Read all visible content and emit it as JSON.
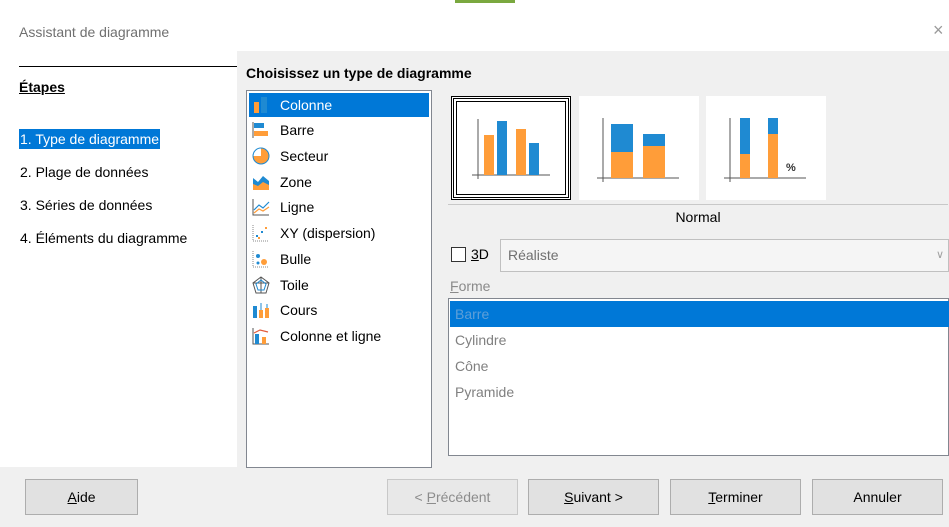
{
  "window": {
    "title": "Assistant de diagramme",
    "close_glyph": "×"
  },
  "steps": {
    "heading": "Étapes",
    "items": [
      {
        "label": "1. Type de diagramme",
        "active": true
      },
      {
        "label": "2. Plage de données",
        "active": false
      },
      {
        "label": "3. Séries de données",
        "active": false
      },
      {
        "label": "4. Éléments du diagramme",
        "active": false
      }
    ]
  },
  "main": {
    "title": "Choisissez un type de diagramme",
    "chart_types": [
      {
        "label": "Colonne",
        "icon": "column-chart-icon",
        "selected": true
      },
      {
        "label": "Barre",
        "icon": "bar-chart-icon",
        "selected": false
      },
      {
        "label": "Secteur",
        "icon": "pie-chart-icon",
        "selected": false
      },
      {
        "label": "Zone",
        "icon": "area-chart-icon",
        "selected": false
      },
      {
        "label": "Ligne",
        "icon": "line-chart-icon",
        "selected": false
      },
      {
        "label": "XY (dispersion)",
        "icon": "scatter-chart-icon",
        "selected": false
      },
      {
        "label": "Bulle",
        "icon": "bubble-chart-icon",
        "selected": false
      },
      {
        "label": "Toile",
        "icon": "net-chart-icon",
        "selected": false
      },
      {
        "label": "Cours",
        "icon": "stock-chart-icon",
        "selected": false
      },
      {
        "label": "Colonne et ligne",
        "icon": "column-line-chart-icon",
        "selected": false
      }
    ],
    "variants": {
      "caption": "Normal",
      "items": [
        {
          "name": "normal",
          "icon": "column-normal-icon",
          "selected": true
        },
        {
          "name": "stacked",
          "icon": "column-stacked-icon",
          "selected": false
        },
        {
          "name": "percent-stacked",
          "icon": "column-percent-stacked-icon",
          "selected": false,
          "badge": "%"
        }
      ]
    },
    "three_d": {
      "label_underlined": "3",
      "label_rest": "D",
      "checked": false,
      "combo_value": "Réaliste",
      "combo_arrow": "∨"
    },
    "shape": {
      "label_underlined": "F",
      "label_rest": "orme",
      "items": [
        {
          "label": "Barre",
          "selected": true
        },
        {
          "label": "Cylindre",
          "selected": false
        },
        {
          "label": "Cône",
          "selected": false
        },
        {
          "label": "Pyramide",
          "selected": false
        }
      ]
    }
  },
  "buttons": {
    "help": {
      "underlined": "A",
      "rest": "ide"
    },
    "previous": {
      "prefix": "< ",
      "underlined": "P",
      "rest": "récédent",
      "disabled": true
    },
    "next": {
      "underlined": "S",
      "rest": "uivant >"
    },
    "finish": {
      "underlined": "T",
      "rest": "erminer"
    },
    "cancel": {
      "label": "Annuler"
    }
  },
  "colors": {
    "accent": "#0078d7",
    "chart_blue": "#1f8ad2",
    "chart_orange": "#ff9d39",
    "title_strip_green": "#7aa83f"
  }
}
